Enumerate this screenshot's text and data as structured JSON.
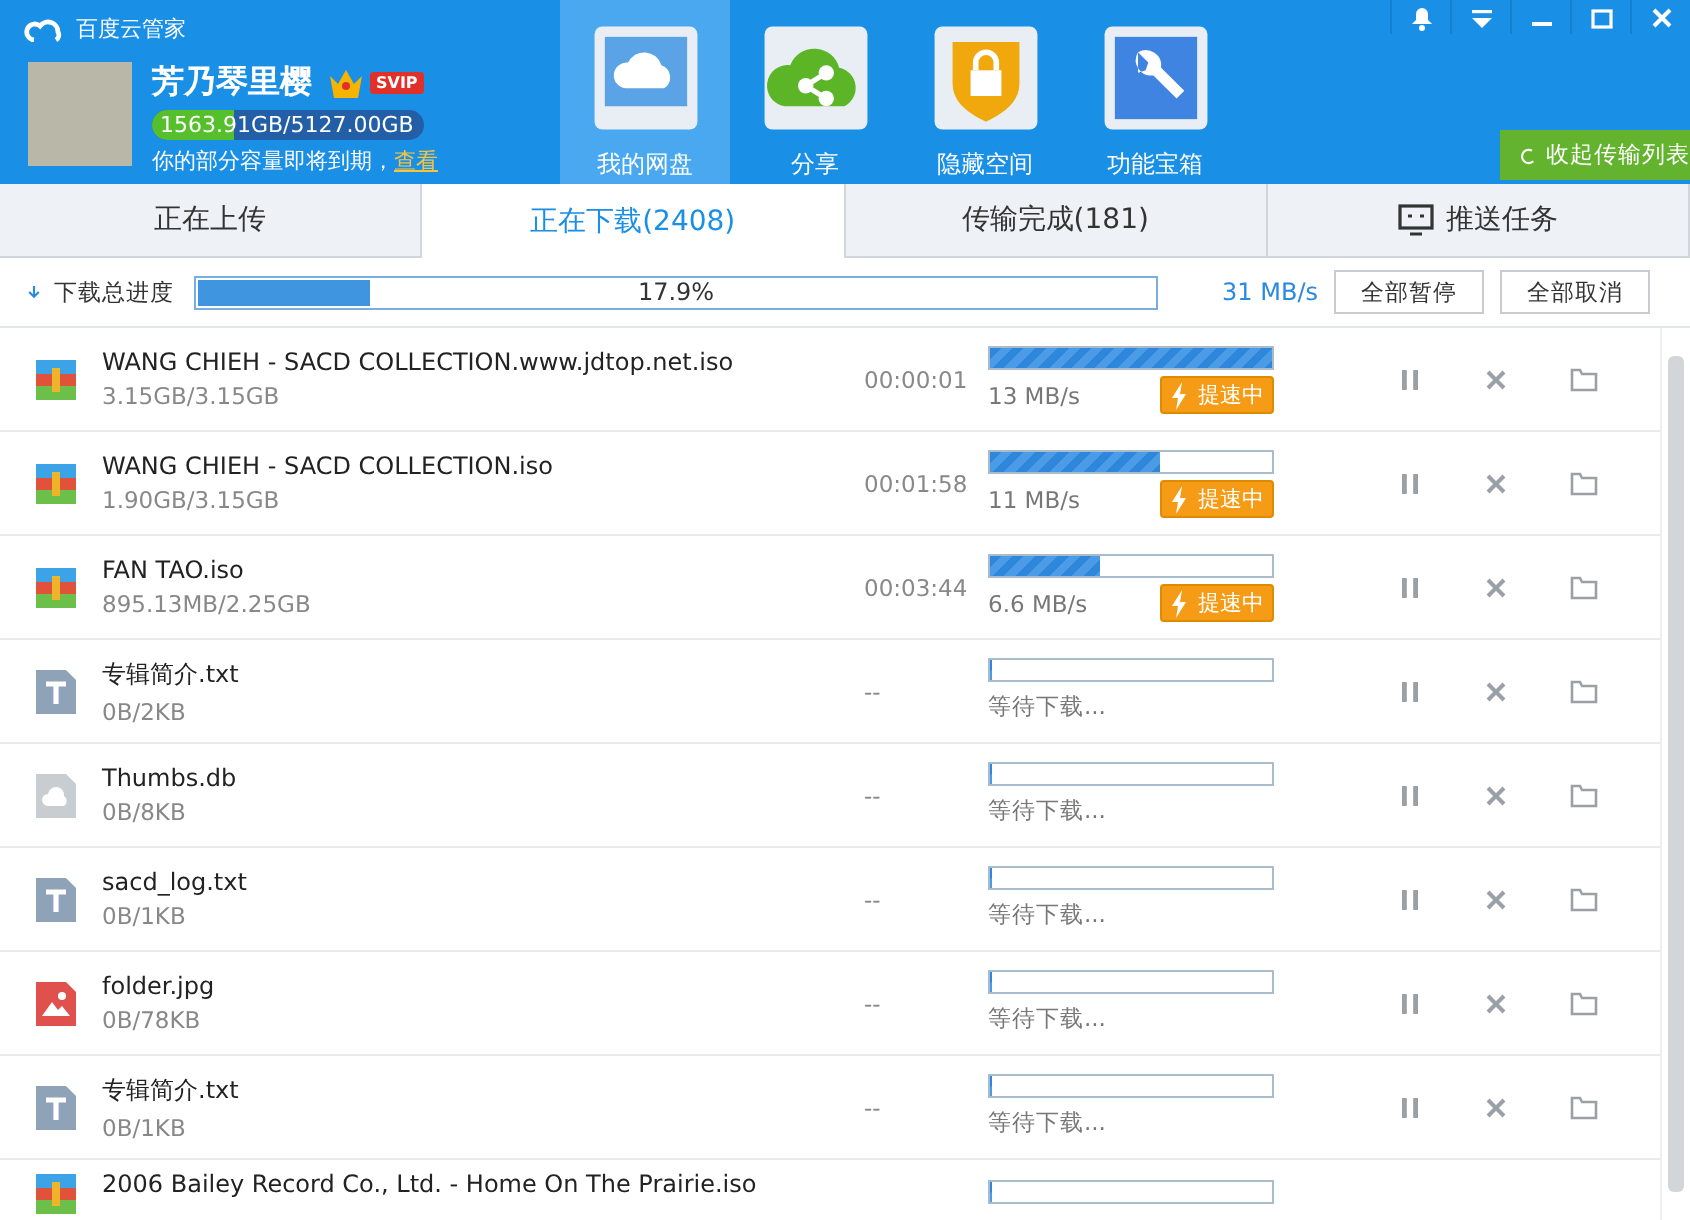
{
  "window": {
    "title": "百度云管家"
  },
  "user": {
    "name": "芳乃琴里樱",
    "badge": "SVIP",
    "storage": "1563.91GB/5127.00GB",
    "level": 0.305,
    "notice": "你的部分容量即将到期，",
    "notice_link": "查看"
  },
  "nav": [
    {
      "label": "我的网盘",
      "kind": "disk",
      "selected": true
    },
    {
      "label": "分享",
      "kind": "share",
      "selected": false
    },
    {
      "label": "隐藏空间",
      "kind": "lock",
      "selected": false
    },
    {
      "label": "功能宝箱",
      "kind": "tools",
      "selected": false
    }
  ],
  "collapse_button": "收起传输列表",
  "tabs": [
    {
      "label": "正在上传",
      "selected": false
    },
    {
      "label": "正在下载(2408)",
      "selected": true
    },
    {
      "label": "传输完成(181)",
      "selected": false
    },
    {
      "label": "推送任务",
      "selected": false
    }
  ],
  "total": {
    "label": "下载总进度",
    "level": 0.179,
    "reading": "17.9%",
    "speed": "31 MB/s",
    "buttons": [
      "全部暂停",
      "全部取消"
    ]
  },
  "downloads": [
    {
      "kind": "archive",
      "name": "WANG CHIEH - SACD COLLECTION.www.jdtop.net.iso",
      "size": "3.15GB/3.15GB",
      "time": "00:00:01",
      "level": 1.0,
      "speed": "13 MB/s",
      "boost": "提速中"
    },
    {
      "kind": "archive",
      "name": "WANG CHIEH - SACD COLLECTION.iso",
      "size": "1.90GB/3.15GB",
      "time": "00:01:58",
      "level": 0.6,
      "speed": "11 MB/s",
      "boost": "提速中"
    },
    {
      "kind": "archive",
      "name": "FAN TAO.iso",
      "size": "895.13MB/2.25GB",
      "time": "00:03:44",
      "level": 0.39,
      "speed": "6.6 MB/s",
      "boost": "提速中"
    },
    {
      "kind": "text",
      "name": "专辑简介.txt",
      "size": "0B/2KB",
      "time": "--",
      "level": 0,
      "status": "等待下载..."
    },
    {
      "kind": "cloud",
      "name": "Thumbs.db",
      "size": "0B/8KB",
      "time": "--",
      "level": 0,
      "status": "等待下载..."
    },
    {
      "kind": "text",
      "name": "sacd_log.txt",
      "size": "0B/1KB",
      "time": "--",
      "level": 0,
      "status": "等待下载..."
    },
    {
      "kind": "image",
      "name": "folder.jpg",
      "size": "0B/78KB",
      "time": "--",
      "level": 0,
      "status": "等待下载..."
    },
    {
      "kind": "text",
      "name": "专辑简介.txt",
      "size": "0B/1KB",
      "time": "--",
      "level": 0,
      "status": "等待下载..."
    },
    {
      "kind": "archive",
      "name": "2006 Bailey Record Co., Ltd. - Home On The Prairie.iso",
      "level": 0
    }
  ]
}
